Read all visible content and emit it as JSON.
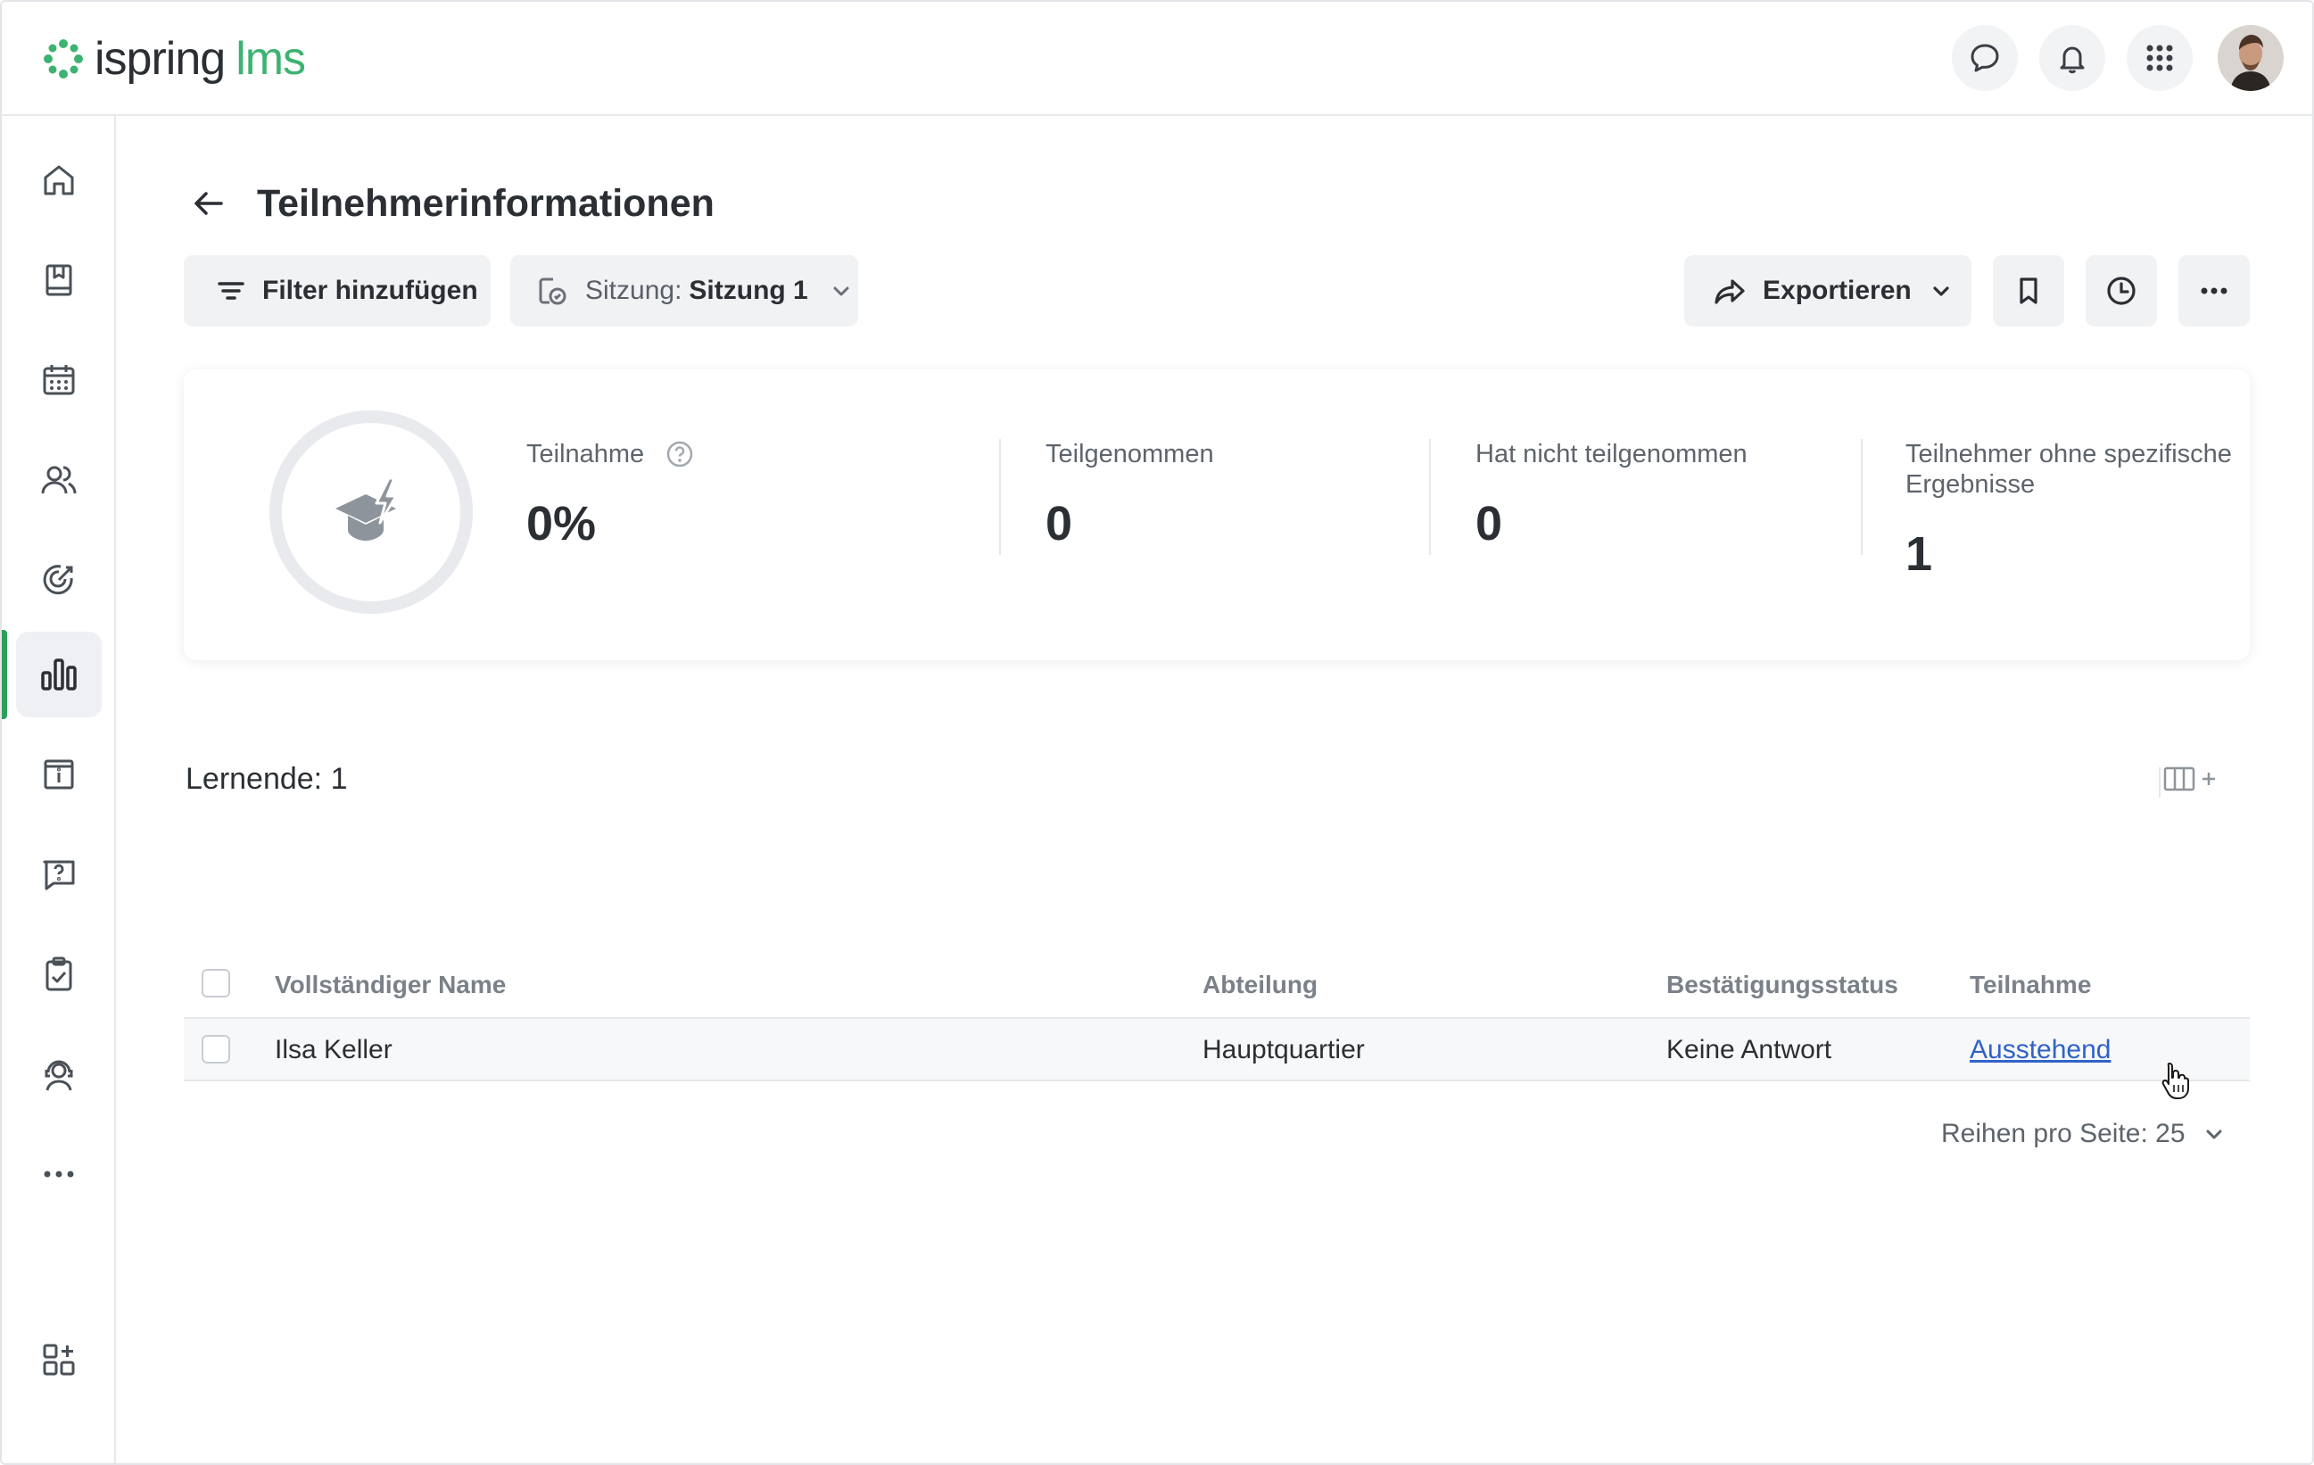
{
  "app": {
    "logo_part1": "ispring",
    "logo_part2": "lms",
    "colors": {
      "brand_green": "#3cb371",
      "active_green": "#2f9e57",
      "link_blue": "#2f63c8"
    }
  },
  "topbar": {
    "icons": [
      "chat-icon",
      "bell-icon",
      "apps-grid-icon",
      "user-avatar"
    ]
  },
  "sidebar": {
    "items": [
      {
        "icon": "home-icon"
      },
      {
        "icon": "book-icon"
      },
      {
        "icon": "calendar-icon"
      },
      {
        "icon": "users-icon"
      },
      {
        "icon": "target-icon"
      },
      {
        "icon": "reports-chart-icon",
        "active": true
      },
      {
        "icon": "info-icon"
      },
      {
        "icon": "question-icon"
      },
      {
        "icon": "clipboard-check-icon"
      },
      {
        "icon": "support-agent-icon"
      },
      {
        "icon": "more-horizontal-icon"
      },
      {
        "icon": "add-widget-icon"
      }
    ]
  },
  "page": {
    "title": "Teilnehmerinformationen"
  },
  "toolbar": {
    "filter_label": "Filter hinzufügen",
    "session_prefix": "Sitzung:",
    "session_value": "Sitzung 1",
    "export_label": "Exportieren"
  },
  "stats": {
    "participation_label": "Teilnahme",
    "participation_value": "0%",
    "attended_label": "Teilgenommen",
    "attended_value": "0",
    "not_attended_label": "Hat nicht teilgenommen",
    "not_attended_value": "0",
    "no_results_label": "Teilnehmer ohne spezifische Ergebnisse",
    "no_results_value": "1"
  },
  "table": {
    "count_label": "Lernende: 1",
    "columns": [
      "Vollständiger Name",
      "Abteilung",
      "Bestätigungsstatus",
      "Teilnahme"
    ],
    "rows": [
      {
        "name": "Ilsa Keller",
        "department": "Hauptquartier",
        "confirmation": "Keine Antwort",
        "participation": "Ausstehend"
      }
    ],
    "rows_per_page": "Reihen pro Seite: 25"
  }
}
